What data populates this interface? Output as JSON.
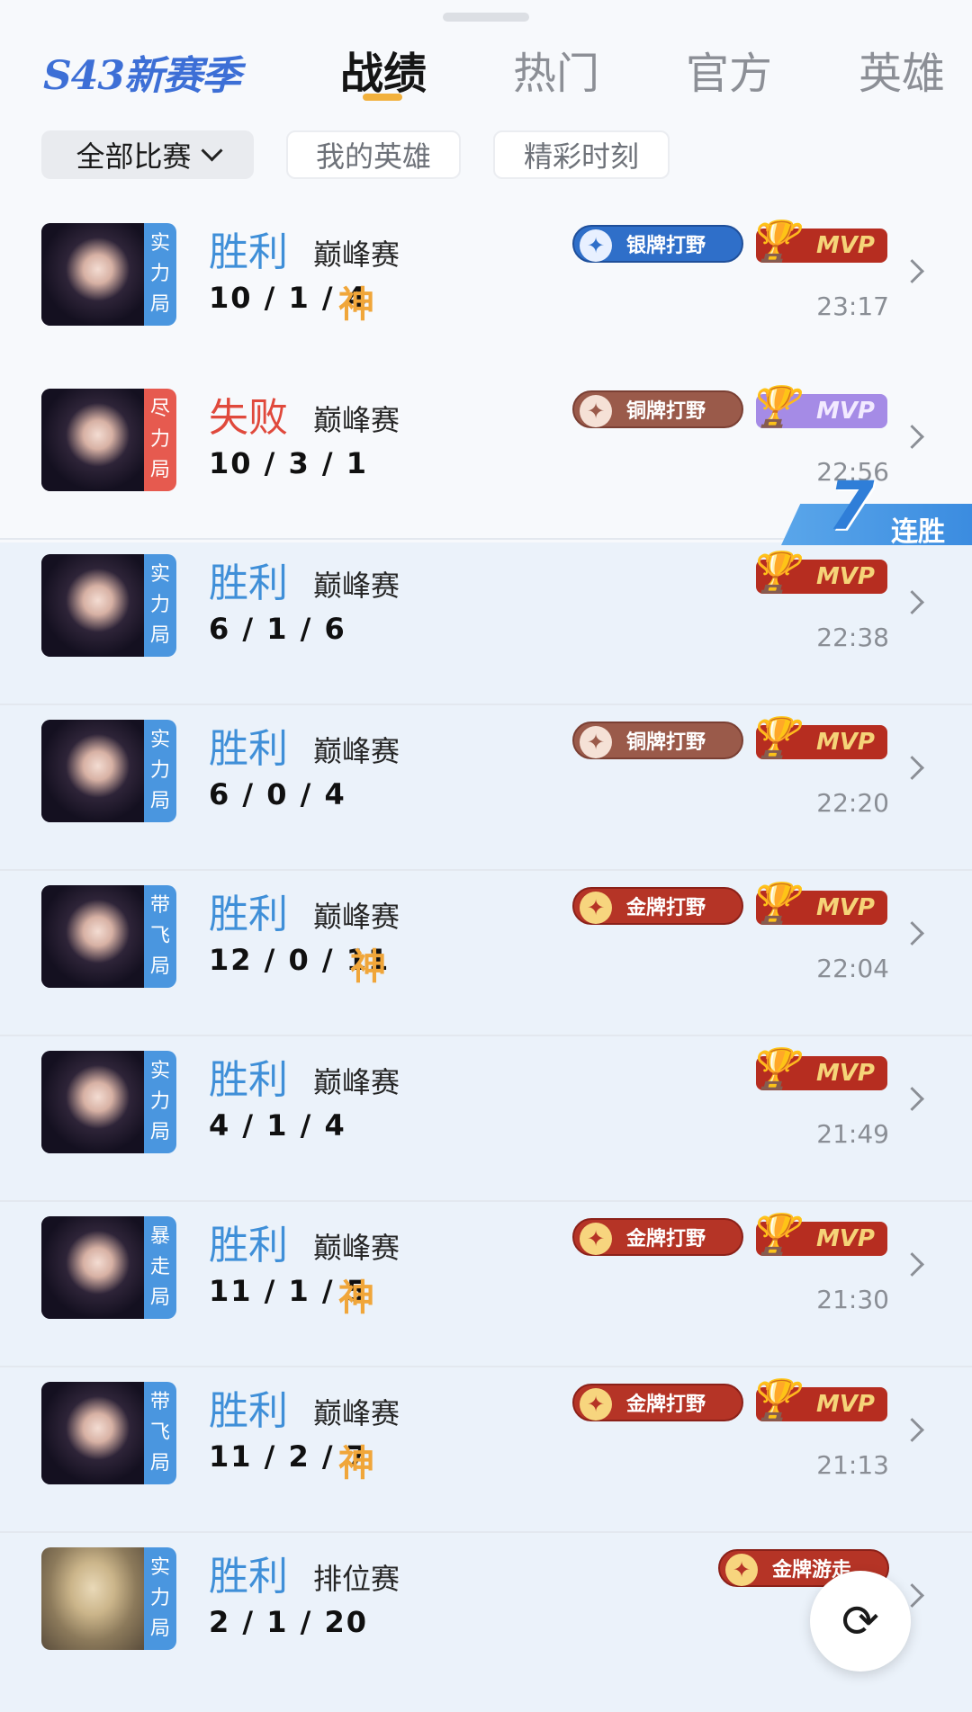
{
  "header": {
    "season": "S43新赛季",
    "tabs": [
      {
        "label": "战绩",
        "active": true
      },
      {
        "label": "热门",
        "active": false
      },
      {
        "label": "官方",
        "active": false
      },
      {
        "label": "英雄",
        "active": false
      }
    ]
  },
  "filters": {
    "dropdown": "全部比赛",
    "chip1": "我的英雄",
    "chip2": "精彩时刻"
  },
  "streak": {
    "count": "7",
    "label": "连胜"
  },
  "matches": [
    {
      "tag": [
        "实",
        "力",
        "局"
      ],
      "tag_color": "blue",
      "result": "胜利",
      "mode": "巅峰赛",
      "kda": "10 / 1 / 4",
      "god": "神",
      "role_badge": "银牌打野",
      "role_tier": "silver",
      "mvp": "MVP",
      "mvp_tier": "gold",
      "time": "23:17"
    },
    {
      "tag": [
        "尽",
        "力",
        "局"
      ],
      "tag_color": "red",
      "result": "失败",
      "mode": "巅峰赛",
      "kda": "10 / 3 / 1",
      "god": "",
      "role_badge": "铜牌打野",
      "role_tier": "bronze",
      "mvp": "MVP",
      "mvp_tier": "purple",
      "time": "22:56"
    },
    {
      "tag": [
        "实",
        "力",
        "局"
      ],
      "tag_color": "blue",
      "result": "胜利",
      "mode": "巅峰赛",
      "kda": "6 / 1 / 6",
      "god": "",
      "role_badge": "",
      "role_tier": "",
      "mvp": "MVP",
      "mvp_tier": "gold",
      "time": "22:38"
    },
    {
      "tag": [
        "实",
        "力",
        "局"
      ],
      "tag_color": "blue",
      "result": "胜利",
      "mode": "巅峰赛",
      "kda": "6 / 0 / 4",
      "god": "",
      "role_badge": "铜牌打野",
      "role_tier": "bronze",
      "mvp": "MVP",
      "mvp_tier": "gold",
      "time": "22:20"
    },
    {
      "tag": [
        "带",
        "飞",
        "局"
      ],
      "tag_color": "blue",
      "result": "胜利",
      "mode": "巅峰赛",
      "kda": "12 / 0 / 11",
      "god": "神",
      "role_badge": "金牌打野",
      "role_tier": "gold",
      "mvp": "MVP",
      "mvp_tier": "gold",
      "time": "22:04"
    },
    {
      "tag": [
        "实",
        "力",
        "局"
      ],
      "tag_color": "blue",
      "result": "胜利",
      "mode": "巅峰赛",
      "kda": "4 / 1 / 4",
      "god": "",
      "role_badge": "",
      "role_tier": "",
      "mvp": "MVP",
      "mvp_tier": "gold",
      "time": "21:49"
    },
    {
      "tag": [
        "暴",
        "走",
        "局"
      ],
      "tag_color": "blue",
      "result": "胜利",
      "mode": "巅峰赛",
      "kda": "11 / 1 / 5",
      "god": "神",
      "role_badge": "金牌打野",
      "role_tier": "gold",
      "mvp": "MVP",
      "mvp_tier": "gold",
      "time": "21:30"
    },
    {
      "tag": [
        "带",
        "飞",
        "局"
      ],
      "tag_color": "blue",
      "result": "胜利",
      "mode": "巅峰赛",
      "kda": "11 / 2 / 7",
      "god": "神",
      "role_badge": "金牌打野",
      "role_tier": "gold",
      "mvp": "MVP",
      "mvp_tier": "gold",
      "time": "21:13"
    },
    {
      "tag": [
        "实",
        "力",
        "局"
      ],
      "tag_color": "blue",
      "result": "胜利",
      "mode": "排位赛",
      "kda": "2 / 1 / 20",
      "god": "",
      "role_badge": "金牌游走",
      "role_tier": "gold",
      "mvp": "",
      "mvp_tier": "",
      "time": ""
    }
  ],
  "icons": {
    "chevron": "chevron-down-icon",
    "arrow": "chevron-right-icon",
    "refresh": "refresh-icon",
    "trophy": "trophy-icon",
    "role": "role-emblem-icon"
  }
}
